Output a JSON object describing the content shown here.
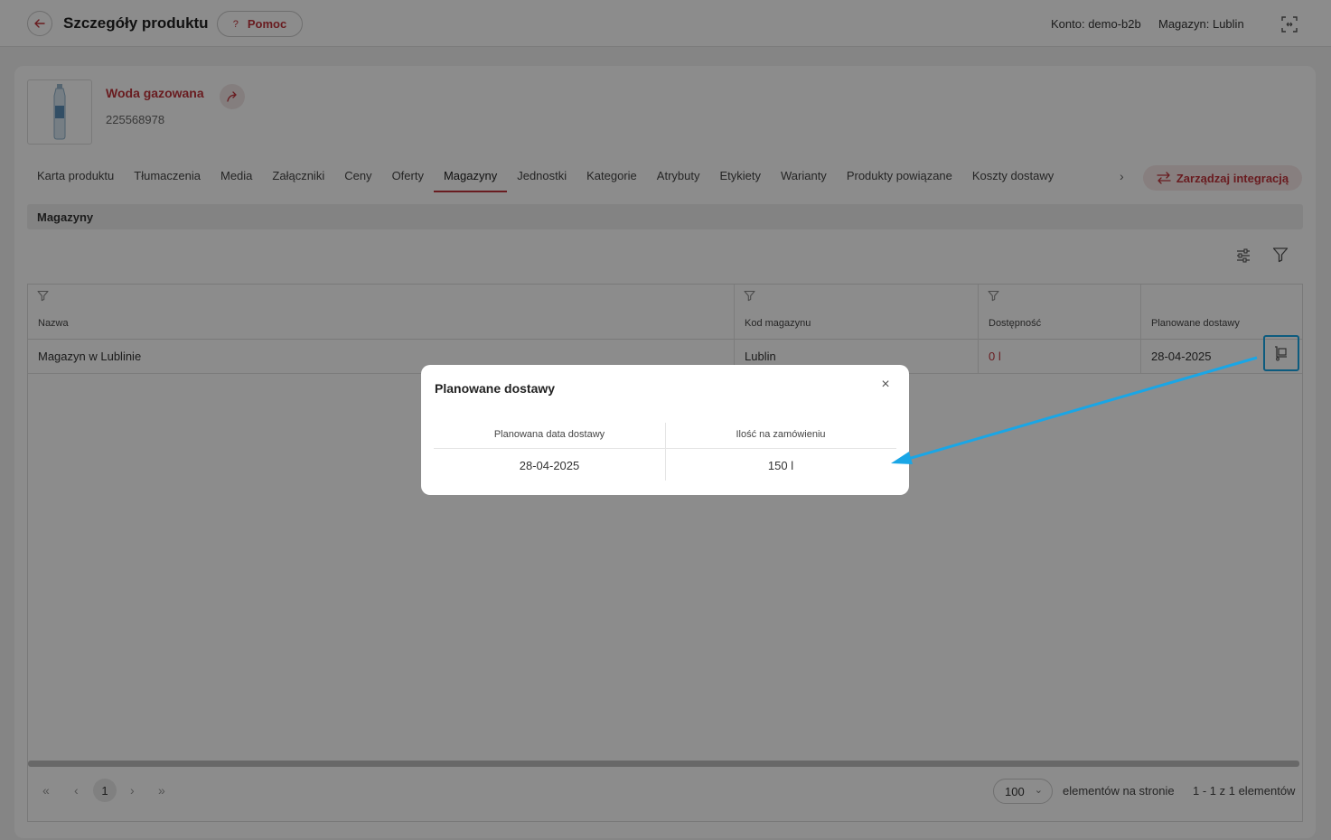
{
  "header": {
    "title": "Szczegóły produktu",
    "help_label": "Pomoc",
    "help_glyph": "?",
    "account": "Konto: demo-b2b",
    "warehouse": "Magazyn: Lublin"
  },
  "product": {
    "name": "Woda gazowana",
    "code": "225568978"
  },
  "tabs": [
    {
      "label": "Karta produktu"
    },
    {
      "label": "Tłumaczenia"
    },
    {
      "label": "Media"
    },
    {
      "label": "Załączniki"
    },
    {
      "label": "Ceny"
    },
    {
      "label": "Oferty"
    },
    {
      "label": "Magazyny"
    },
    {
      "label": "Jednostki"
    },
    {
      "label": "Kategorie"
    },
    {
      "label": "Atrybuty"
    },
    {
      "label": "Etykiety"
    },
    {
      "label": "Warianty"
    },
    {
      "label": "Produkty powiązane"
    },
    {
      "label": "Koszty dostawy"
    }
  ],
  "active_tab": "Magazyny",
  "manage_integration_label": "Zarządzaj integracją",
  "section_title": "Magazyny",
  "grid": {
    "columns": [
      "Nazwa",
      "Kod magazynu",
      "Dostępność",
      "Planowane dostawy"
    ],
    "rows": [
      {
        "name": "Magazyn w Lublinie",
        "code": "Lublin",
        "availability": "0 l",
        "planned": "28-04-2025"
      }
    ]
  },
  "pagination": {
    "current_page": "1",
    "per_page": "100",
    "per_page_label": "elementów na stronie",
    "count_label": "1 - 1 z 1 elementów"
  },
  "modal": {
    "title": "Planowane dostawy",
    "columns": [
      "Planowana data dostawy",
      "Ilość na zamówieniu"
    ],
    "rows": [
      {
        "date": "28-04-2025",
        "qty": "150 l"
      }
    ]
  },
  "colors": {
    "accent": "#c0343b",
    "highlight": "#19a6e6",
    "overlay": "rgba(0,0,0,0.45)"
  }
}
